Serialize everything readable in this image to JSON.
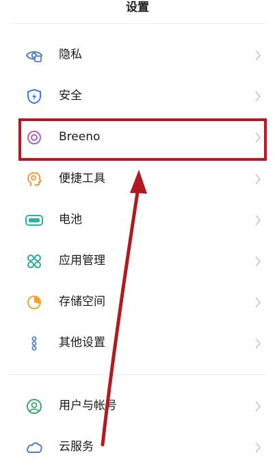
{
  "header": {
    "title": "设置"
  },
  "items": [
    {
      "label": "隐私",
      "icon": "privacy-eye-icon",
      "color": "#4f7ec9"
    },
    {
      "label": "安全",
      "icon": "security-shield-icon",
      "color": "#3e78d8"
    },
    {
      "label": "Breeno",
      "icon": "breeno-icon",
      "color": "#c46aa6"
    },
    {
      "label": "便捷工具",
      "icon": "convenience-tool-icon",
      "color": "#f09a3a"
    },
    {
      "label": "电池",
      "icon": "battery-icon",
      "color": "#2bb4a3"
    },
    {
      "label": "应用管理",
      "icon": "app-management-icon",
      "color": "#2ba89a"
    },
    {
      "label": "存储空间",
      "icon": "storage-icon",
      "color": "#f0a52a"
    },
    {
      "label": "其他设置",
      "icon": "other-settings-icon",
      "color": "#4f7ec9"
    },
    {
      "label": "用户与帐号",
      "icon": "user-account-icon",
      "color": "#3aa56e"
    },
    {
      "label": "云服务",
      "icon": "cloud-service-icon",
      "color": "#4f7ec9"
    }
  ],
  "annotation": {
    "highlight_target": "Breeno",
    "highlight_color": "#c2141c",
    "arrow_color": "#b11a1f"
  }
}
